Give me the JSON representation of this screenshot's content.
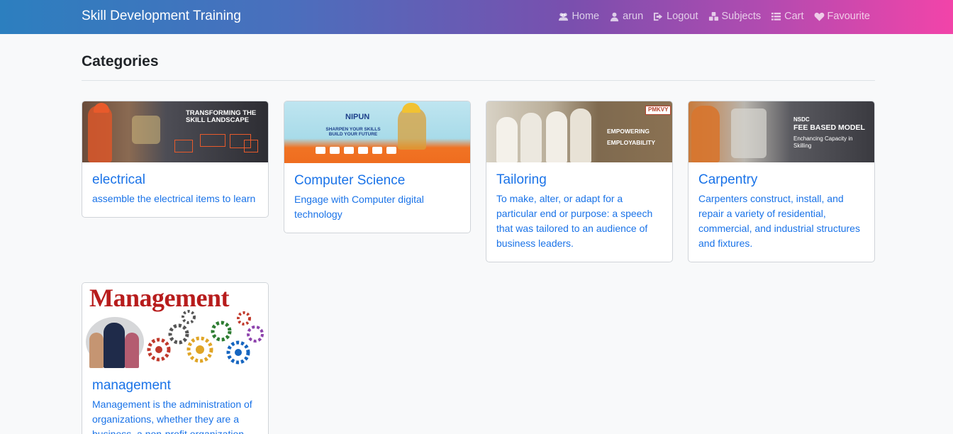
{
  "navbar": {
    "brand": "Skill Development Training",
    "links": [
      {
        "label": "Home",
        "icon": "users-icon"
      },
      {
        "label": "arun",
        "icon": "user-icon"
      },
      {
        "label": "Logout",
        "icon": "logout-icon"
      },
      {
        "label": "Subjects",
        "icon": "cubes-icon"
      },
      {
        "label": "Cart",
        "icon": "list-icon"
      },
      {
        "label": "Favourite",
        "icon": "heart-icon"
      }
    ]
  },
  "page": {
    "heading": "Categories"
  },
  "categories": [
    {
      "title": "electrical",
      "description": "assemble the electrical items to learn",
      "image_text": "TRANSFORMING THE SKILL LANDSCAPE"
    },
    {
      "title": "Computer Science",
      "description": "Engage with Computer digital technology",
      "image_text": "SHARPEN YOUR SKILLS BUILD YOUR FUTURE",
      "image_logo": "NIPUN"
    },
    {
      "title": "Tailoring",
      "description": "To make, alter, or adapt for a particular end or purpose: a speech that was tailored to an audience of business leaders.",
      "image_text": "EMPOWERING",
      "image_text_2": "EMPLOYABILITY",
      "image_logo": "PMKVY"
    },
    {
      "title": "Carpentry",
      "description": "Carpenters construct, install, and repair a variety of residential, commercial, and industrial structures and fixtures.",
      "image_text": "NSDC",
      "image_text_2": "FEE BASED MODEL",
      "image_text_3": "Enchancing Capacity in Skilling"
    },
    {
      "title": "management",
      "description": "Management is the administration of organizations, whether they are a business, a non-profit organization",
      "image_text": "Management"
    }
  ]
}
